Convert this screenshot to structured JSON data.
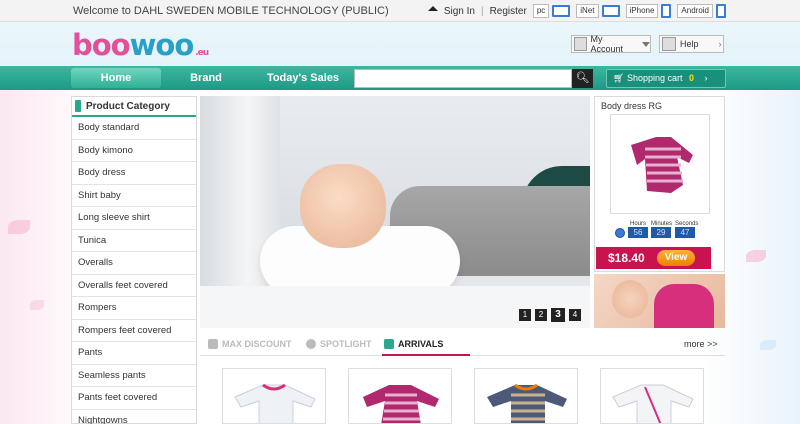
{
  "topbar": {
    "welcome": "Welcome to DAHL SWEDEN MOBILE TECHNOLOGY (PUBLIC)",
    "sign_in": "Sign In",
    "separator": "|",
    "register": "Register",
    "devices": [
      {
        "label": "pc",
        "icon": "monitor-icon"
      },
      {
        "label": "iNet",
        "icon": "laptop-icon"
      },
      {
        "label": "iPhone",
        "icon": "phone-icon"
      },
      {
        "label": "Android",
        "icon": "phone-icon"
      }
    ]
  },
  "header": {
    "logo_part1": "boo",
    "logo_part2": "woo",
    "logo_suffix": ".eu",
    "account_label": "My Account",
    "help_label": "Help"
  },
  "nav": {
    "items": [
      "Home",
      "Brand",
      "Today's Sales"
    ],
    "search_placeholder": "",
    "cart_label": "Shopping cart",
    "cart_count": "0"
  },
  "sidebar": {
    "title": "Product Category",
    "items": [
      "Body standard",
      "Body kimono",
      "Body dress",
      "Shirt baby",
      "Long sleeve shirt",
      "Tunica",
      "Overalls",
      "Overalls feet covered",
      "Rompers",
      "Rompers feet covered",
      "Pants",
      "Seamless pants",
      "Pants feet covered",
      "Nightgowns"
    ]
  },
  "banner": {
    "pages": [
      "1",
      "2",
      "3",
      "4"
    ],
    "active_page": "3"
  },
  "deal": {
    "title": "Body dress RG",
    "hours_label": "Hours",
    "minutes_label": "Minutes",
    "seconds_label": "Seconds",
    "hours": "56",
    "minutes": "29",
    "seconds": "47",
    "price": "$18.40",
    "view_label": "View"
  },
  "tabs": {
    "items": [
      "MAX DISCOUNT",
      "SPOTLIGHT",
      "ARRIVALS"
    ],
    "active": "ARRIVALS",
    "more": "more >>"
  },
  "colors": {
    "accent_green": "#1c9a86",
    "brand_pink": "#e0509b",
    "brand_blue": "#2aa0c6",
    "price_red": "#c8134f",
    "button_orange": "#f07d00"
  }
}
